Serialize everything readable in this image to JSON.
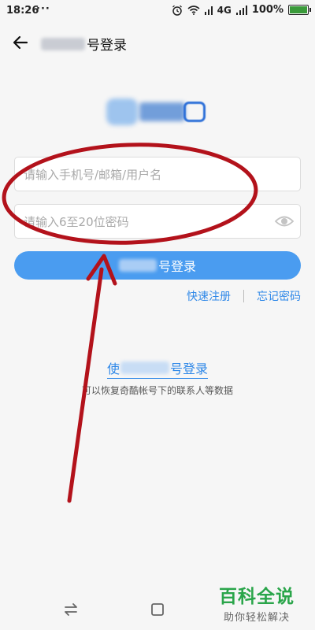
{
  "status_bar": {
    "time": "18:26",
    "dots": "···",
    "network": "4G",
    "battery": "100%"
  },
  "header": {
    "title_suffix": "号登录"
  },
  "form": {
    "username_placeholder": "请输入手机号/邮箱/用户名",
    "password_placeholder": "请输入6至20位密码",
    "login_button_suffix": "号登录"
  },
  "links": {
    "register": "快速注册",
    "forgot": "忘记密码"
  },
  "alt_login": {
    "prefix": "使",
    "suffix": "号登录",
    "subtitle": "可以恢复奇酷帐号下的联系人等数据"
  },
  "watermark": {
    "main": "百科全说",
    "sub": "助你轻松解决"
  },
  "colors": {
    "accent": "#4a9cf0",
    "link": "#2f88e8",
    "annotation": "#b3121b",
    "watermark": "#2aa54a"
  },
  "icons": {
    "back": "arrow-left-icon",
    "eye": "eye-icon",
    "alarm": "alarm-icon",
    "wifi": "wifi-icon",
    "signal": "signal-icon",
    "battery": "battery-icon",
    "nav_back": "nav-back-icon",
    "nav_home": "nav-home-icon"
  }
}
